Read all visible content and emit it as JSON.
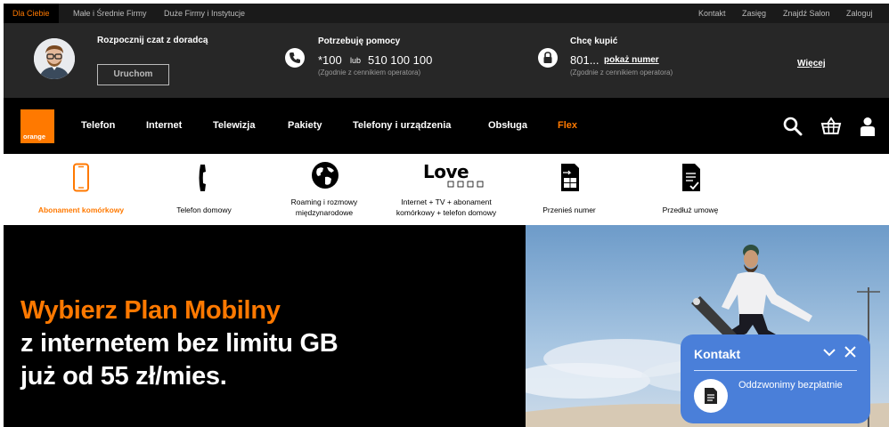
{
  "topbar": {
    "tabs": [
      "Dla Ciebie",
      "Małe i Średnie Firmy",
      "Duże Firmy i Instytucje"
    ],
    "links": [
      "Kontakt",
      "Zasięg",
      "Znajdź Salon",
      "Zaloguj"
    ]
  },
  "help": {
    "chat_title": "Rozpocznij czat z doradcą",
    "chat_button": "Uruchom",
    "help_title": "Potrzebuję pomocy",
    "help_num1": "*100",
    "help_or": "lub",
    "help_num2": "510 100 100",
    "help_note": "(Zgodnie z cennikiem operatora)",
    "buy_title": "Chcę kupić",
    "buy_num": "801...",
    "buy_show": "pokaż numer",
    "buy_note": "(Zgodnie z cennikiem operatora)",
    "more": "Więcej"
  },
  "nav": {
    "logo": "orange",
    "items": [
      "Telefon",
      "Internet",
      "Telewizja",
      "Pakiety",
      "Telefony i urządzenia",
      "Obsługa",
      "Flex"
    ],
    "accent": "#ff7900"
  },
  "subnav": {
    "items": [
      {
        "line1": "Abonament komórkowy",
        "line2": "",
        "icon": "smartphone-icon"
      },
      {
        "line1": "Telefon domowy",
        "line2": "",
        "icon": "handset-icon"
      },
      {
        "line1": "Roaming i rozmowy",
        "line2": "międzynarodowe",
        "icon": "globe-icon"
      },
      {
        "line1": "Internet + TV + abonament",
        "line2": "komórkowy + telefon domowy",
        "icon": "love-icon"
      },
      {
        "line1": "Przenieś numer",
        "line2": "",
        "icon": "sim-card-icon"
      },
      {
        "line1": "Przedłuż umowę",
        "line2": "",
        "icon": "document-check-icon"
      }
    ],
    "love_text": "Love"
  },
  "hero": {
    "line1": "Wybierz Plan Mobilny",
    "line2": "z internetem bez limitu GB",
    "line3": "już od 55 zł/mies."
  },
  "contact": {
    "title": "Kontakt",
    "callback": "Oddzwonimy bezpłatnie",
    "bg": "#4a7fd9"
  }
}
